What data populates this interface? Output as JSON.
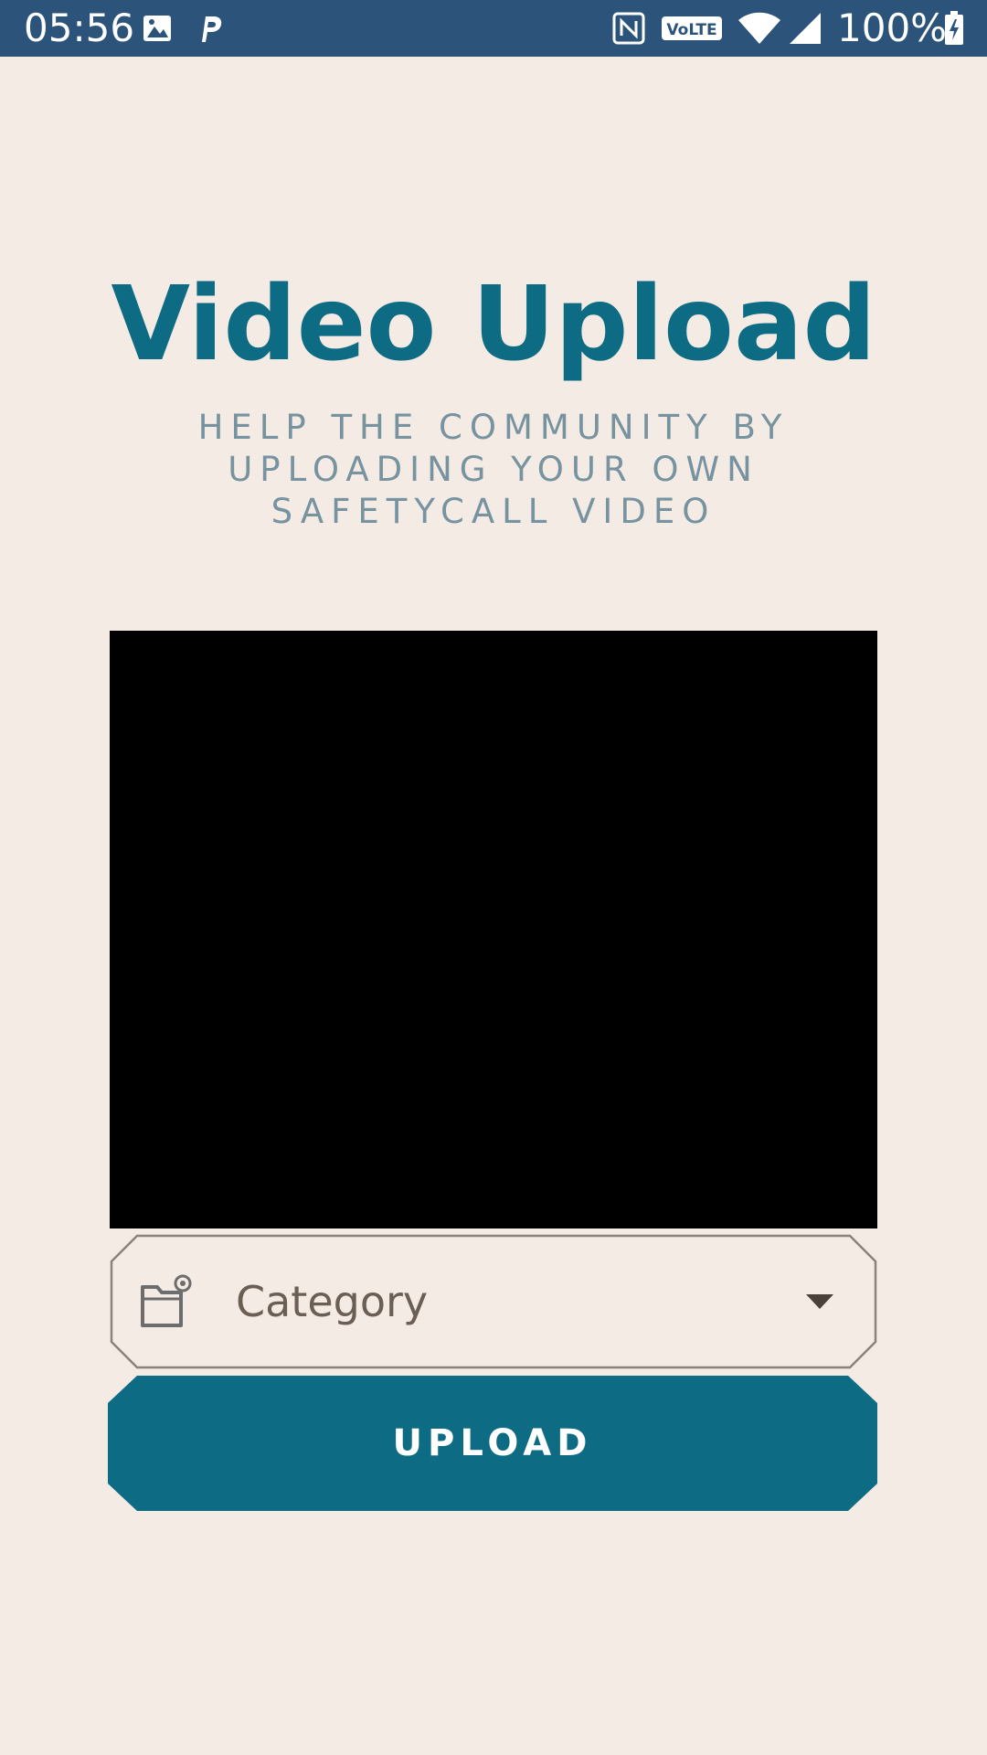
{
  "status_bar": {
    "time": "05:56",
    "battery_text": "100%",
    "icons": [
      "image-icon",
      "parking-icon",
      "nfc-icon",
      "volte-icon",
      "wifi-icon",
      "signal-icon",
      "battery-charging-icon"
    ],
    "volte_label": "VoLTE",
    "background_color": "#2c5379"
  },
  "header": {
    "title": "Video Upload",
    "subtitle": "HELP THE COMMUNITY BY UPLOADING YOUR OWN SAFETYCALL VIDEO",
    "title_color": "#0d6c84",
    "subtitle_color": "#7793a0"
  },
  "video": {
    "background_color": "#000000"
  },
  "category": {
    "placeholder": "Category",
    "icon": "folder-icon",
    "arrow_icon": "dropdown-arrow-icon"
  },
  "upload": {
    "label": "UPLOAD",
    "color": "#0d6c84"
  },
  "page": {
    "background_color": "#f3ebe4"
  }
}
